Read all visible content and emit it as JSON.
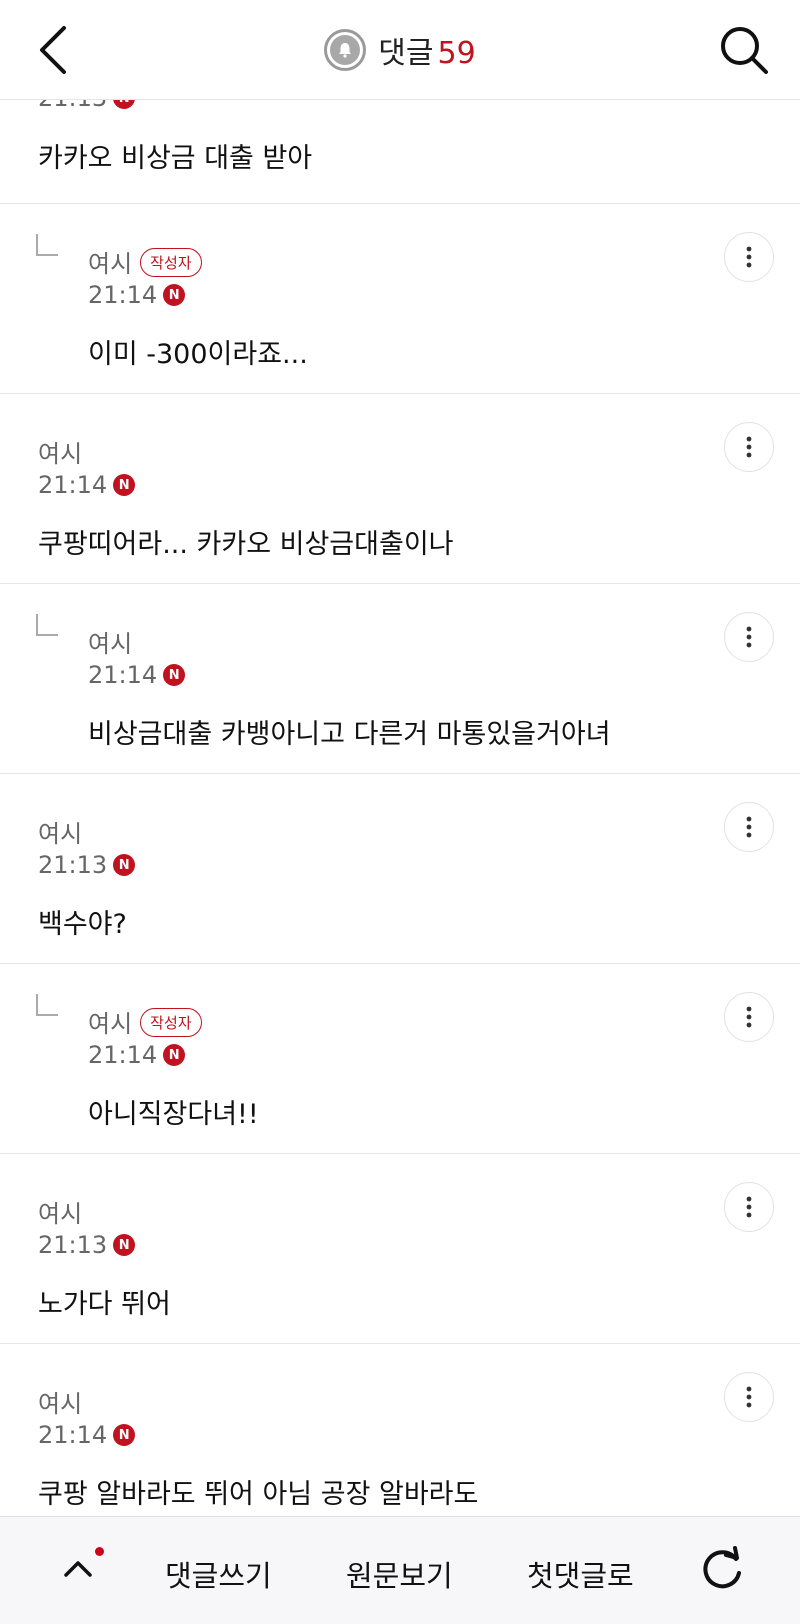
{
  "header": {
    "title": "댓글",
    "count": "59"
  },
  "top_comment": {
    "time": "21:13",
    "body": "카카오 비상금 대출 받아"
  },
  "new_badge": "N",
  "comments": [
    {
      "author": "여시",
      "author_tag": "작성자",
      "time": "21:14",
      "body": "이미 -300이라죠...",
      "reply": true
    },
    {
      "author": "여시",
      "author_tag": "",
      "time": "21:14",
      "body": "쿠팡띠어라... 카카오 비상금대출이나",
      "reply": false
    },
    {
      "author": "여시",
      "author_tag": "",
      "time": "21:14",
      "body": "비상금대출 카뱅아니고 다른거 마통있을거아녀",
      "reply": true
    },
    {
      "author": "여시",
      "author_tag": "",
      "time": "21:13",
      "body": "백수야?",
      "reply": false
    },
    {
      "author": "여시",
      "author_tag": "작성자",
      "time": "21:14",
      "body": "아니직장다녀!!",
      "reply": true
    },
    {
      "author": "여시",
      "author_tag": "",
      "time": "21:13",
      "body": "노가다 뛰어",
      "reply": false
    },
    {
      "author": "여시",
      "author_tag": "",
      "time": "21:14",
      "body": "쿠팡 알바라도 뛰어 아님 공장 알바라도",
      "reply": false
    }
  ],
  "bottom_bar": {
    "write": "댓글쓰기",
    "view_original": "원문보기",
    "first_comment": "첫댓글로"
  },
  "icons": {
    "back": "back-arrow-icon",
    "search": "search-icon",
    "bell": "bell-icon",
    "more": "more-vertical-icon",
    "scroll_top": "chevron-up-icon",
    "refresh": "refresh-icon"
  },
  "colors": {
    "accent": "#c1121f"
  }
}
